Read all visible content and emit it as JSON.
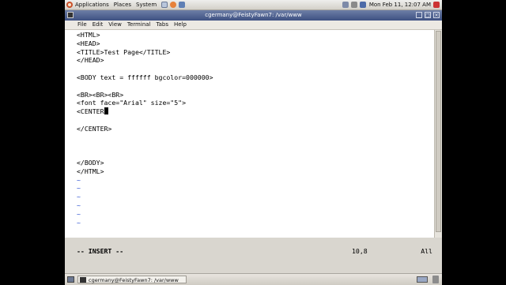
{
  "top_panel": {
    "menus": [
      "Applications",
      "Places",
      "System"
    ],
    "clock": "Mon Feb 11, 12:07 AM"
  },
  "terminal": {
    "title": "cgermany@FeistyFawn7: /var/www",
    "menu_items": [
      "File",
      "Edit",
      "View",
      "Terminal",
      "Tabs",
      "Help"
    ],
    "lines": [
      "<HTML>",
      "<HEAD>",
      "<TITLE>Test Page</TITLE>",
      "</HEAD>",
      "",
      "<BODY text = ffffff bgcolor=000000>",
      "",
      "<BR><BR><BR>",
      "<font face=\"Arial\" size=\"5\">",
      "<CENTER",
      "",
      "</CENTER>",
      "",
      "",
      "",
      "</BODY>",
      "</HTML>"
    ],
    "tilde_lines": [
      "~",
      "~",
      "~",
      "~",
      "~",
      "~"
    ],
    "status": {
      "mode": "-- INSERT --",
      "position": "10,8",
      "scroll": "All"
    }
  },
  "bottom_panel": {
    "task_label": "cgermany@FeistyFawn7: /var/www"
  },
  "colors": {
    "title_bar": "#4a5d8f",
    "tilde": "#2a4fd1",
    "terminal_bg": "#ffffff"
  }
}
